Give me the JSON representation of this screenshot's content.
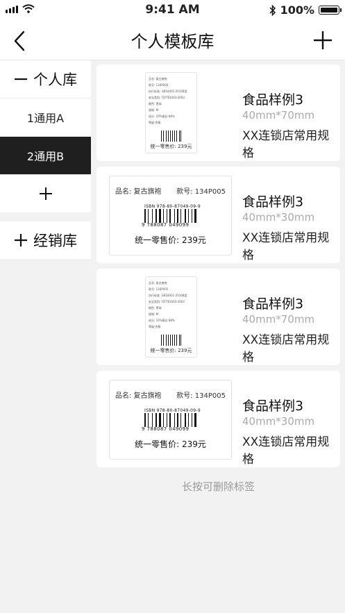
{
  "status": {
    "time": "9:41 AM",
    "battery": "100%"
  },
  "nav": {
    "title": "个人模板库"
  },
  "sidebar": {
    "personal_header": "个人库",
    "items": [
      {
        "label": "1通用A"
      },
      {
        "label": "2通用B"
      }
    ],
    "dealer_header": "经销库"
  },
  "cards": [
    {
      "title": "食品样例3",
      "size": "40mm*70mm",
      "desc": "XX连锁店常用规格",
      "label": {
        "lines": [
          "品名: 复古旗袍",
          "款号: 134P005",
          "执行标准: GB18401-2010B类",
          "安全类别: FZ/T81003-2003",
          "颜色: 黑绿",
          "规格: M",
          "成分: 10%蚕丝 88%",
          "等级:合格"
        ],
        "price": "统一零售价: 239元"
      }
    },
    {
      "title": "食品样例3",
      "size": "40mm*30mm",
      "desc": "XX连锁店常用规格",
      "label": {
        "name": "品名: 复古旗袍",
        "code": "款号: 134P005",
        "isbn": "ISBN 978-80-87049-09-9",
        "digits": "9 788087 049099",
        "price": "统一零售价: 239元"
      }
    },
    {
      "title": "食品样例3",
      "size": "40mm*70mm",
      "desc": "XX连锁店常用规格",
      "label": {
        "lines": [
          "品名: 复古旗袍",
          "款号: 134P005",
          "执行标准: GB18401-2010B类",
          "安全类别: FZ/T81003-2003",
          "颜色: 黑绿",
          "规格: M",
          "成分: 10%蚕丝 88%",
          "等级:合格"
        ],
        "price": "统一零售价: 239元"
      }
    },
    {
      "title": "食品样例3",
      "size": "40mm*30mm",
      "desc": "XX连锁店常用规格",
      "label": {
        "name": "品名: 复古旗袍",
        "code": "款号: 134P005",
        "isbn": "ISBN 978-80-87049-09-9",
        "digits": "9 788087 049099",
        "price": "统一零售价: 239元"
      }
    }
  ],
  "hint": "长按可删除标签"
}
